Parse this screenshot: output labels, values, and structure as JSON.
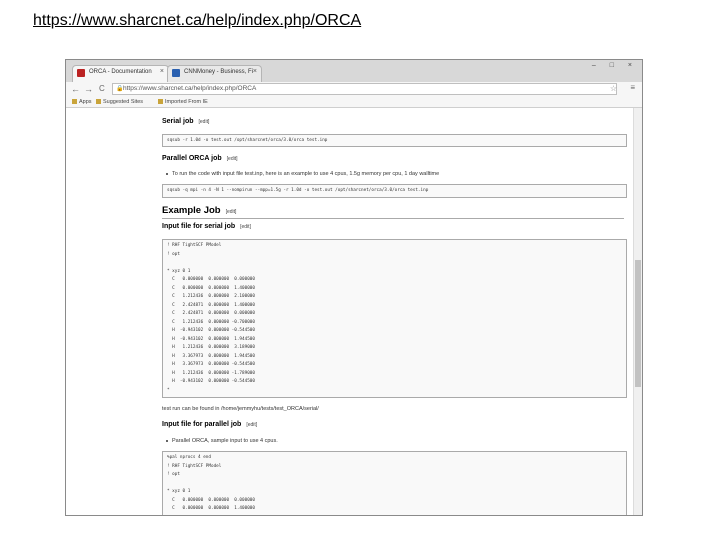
{
  "slide": {
    "link_text": "https://www.sharcnet.ca/help/index.php/ORCA"
  },
  "browser": {
    "tabs": [
      {
        "title": "ORCA - Documentation",
        "close": "×"
      },
      {
        "title": "CNNMoney - Business, Fi",
        "close": "×"
      }
    ],
    "window_controls": "–  □  ×",
    "back": "←",
    "forward": "→",
    "reload": "C",
    "address": "https://www.sharcnet.ca/help/index.php/ORCA",
    "lock_glyph": "🔒",
    "star_glyph": "☆",
    "menu_glyph": "≡",
    "bookmarks": [
      "Apps",
      "Suggested Sites",
      "Imported From IE"
    ]
  },
  "page": {
    "edit_label": "[edit]",
    "serial_job": {
      "heading": "Serial job",
      "code": "sqsub -r 1.0d -o test.out /opt/sharcnet/orca/3.0/orca test.inp"
    },
    "parallel_job": {
      "heading": "Parallel ORCA job",
      "bullet": "To run the code with input file test.inp, here is an example to use 4 cpus, 1.5g memory per cpu, 1 day walltime",
      "code": "sqsub -q mpi -n 4 -N 1 --nompirun --mpp=1.5g -r 1.0d -o test.out /opt/sharcnet/orca/3.0/orca test.inp"
    },
    "example_job": {
      "heading": "Example Job"
    },
    "serial_input": {
      "heading": "Input file for serial job",
      "code_lines": [
        "! RHF TightSCF PModel",
        "! opt",
        "",
        "* xyz 0 1",
        "  C   0.000000  0.000000  0.000000",
        "  C   0.000000  0.000000  1.400000",
        "  C   1.212436  0.000000  2.100000",
        "  C   2.424871  0.000000  1.400000",
        "  C   2.424871  0.000000  0.000000",
        "  C   1.212436  0.000000 -0.700000",
        "  H  -0.943102  0.000000 -0.544500",
        "  H  -0.943102  0.000000  1.944500",
        "  H   1.212436  0.000000  3.189000",
        "  H   3.367973  0.000000  1.944500",
        "  H   3.367973  0.000000 -0.544500",
        "  H   1.212436  0.000000 -1.789000",
        "  H  -0.943102  0.000000 -0.544500",
        "*"
      ]
    },
    "test_run_note": "test run can be found in /home/jemmyhu/tests/test_ORCA/serial/",
    "parallel_input": {
      "heading": "Input file for parallel job",
      "bullet": "Parallel ORCA, sample input to use 4 cpus.",
      "code_lines": [
        "%pal nprocs 4 end",
        "! RHF TightSCF PModel",
        "! opt",
        "",
        "* xyz 0 1",
        "  C   0.000000  0.000000  0.000000",
        "  C   0.000000  0.000000  1.400000"
      ]
    }
  }
}
